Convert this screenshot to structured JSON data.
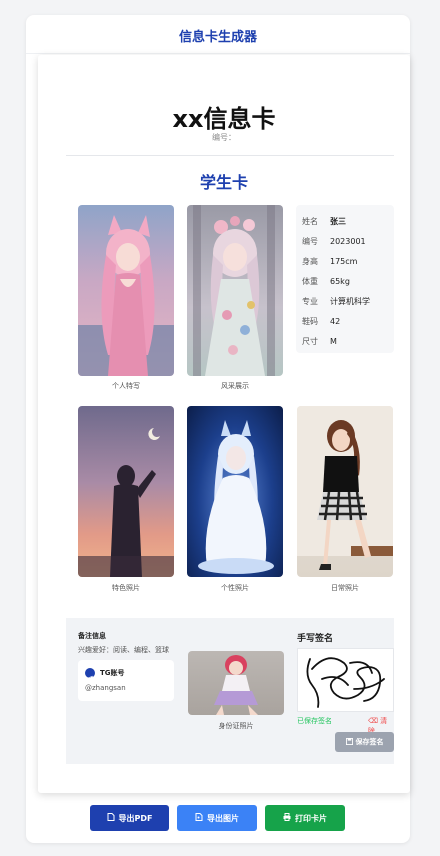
{
  "app": {
    "title": "信息卡生成器"
  },
  "card": {
    "title": "xx信息卡",
    "number_label": "编号：",
    "subtitle": "学生卡"
  },
  "photos": {
    "personal_caption": "个人特写",
    "style_caption": "风采展示",
    "featured_caption": "特色照片",
    "character_caption": "个性照片",
    "daily_caption": "日常照片"
  },
  "info": [
    {
      "label": "姓名",
      "value": "张三"
    },
    {
      "label": "编号",
      "value": "2023001"
    },
    {
      "label": "身高",
      "value": "175cm"
    },
    {
      "label": "体重",
      "value": "65kg"
    },
    {
      "label": "专业",
      "value": "计算机科学"
    },
    {
      "label": "鞋码",
      "value": "42"
    },
    {
      "label": "尺寸",
      "value": "M"
    }
  ],
  "notes": {
    "title": "备注信息",
    "hobbies": "兴趣爱好：阅读、编程、篮球"
  },
  "tg": {
    "label": "TG账号",
    "handle": "@zhangsan"
  },
  "id_photo": {
    "caption": "身份证照片"
  },
  "signature": {
    "title": "手写签名",
    "saved_status": "已保存签名",
    "clear_label": "清除",
    "save_label": "保存签名"
  },
  "actions": {
    "export_pdf": "导出PDF",
    "export_image": "导出图片",
    "print_card": "打印卡片"
  },
  "colors": {
    "primary": "#1e40af",
    "blue": "#3b82f6",
    "green": "#16a34a",
    "saved": "#22c55e",
    "danger": "#ef4444"
  }
}
